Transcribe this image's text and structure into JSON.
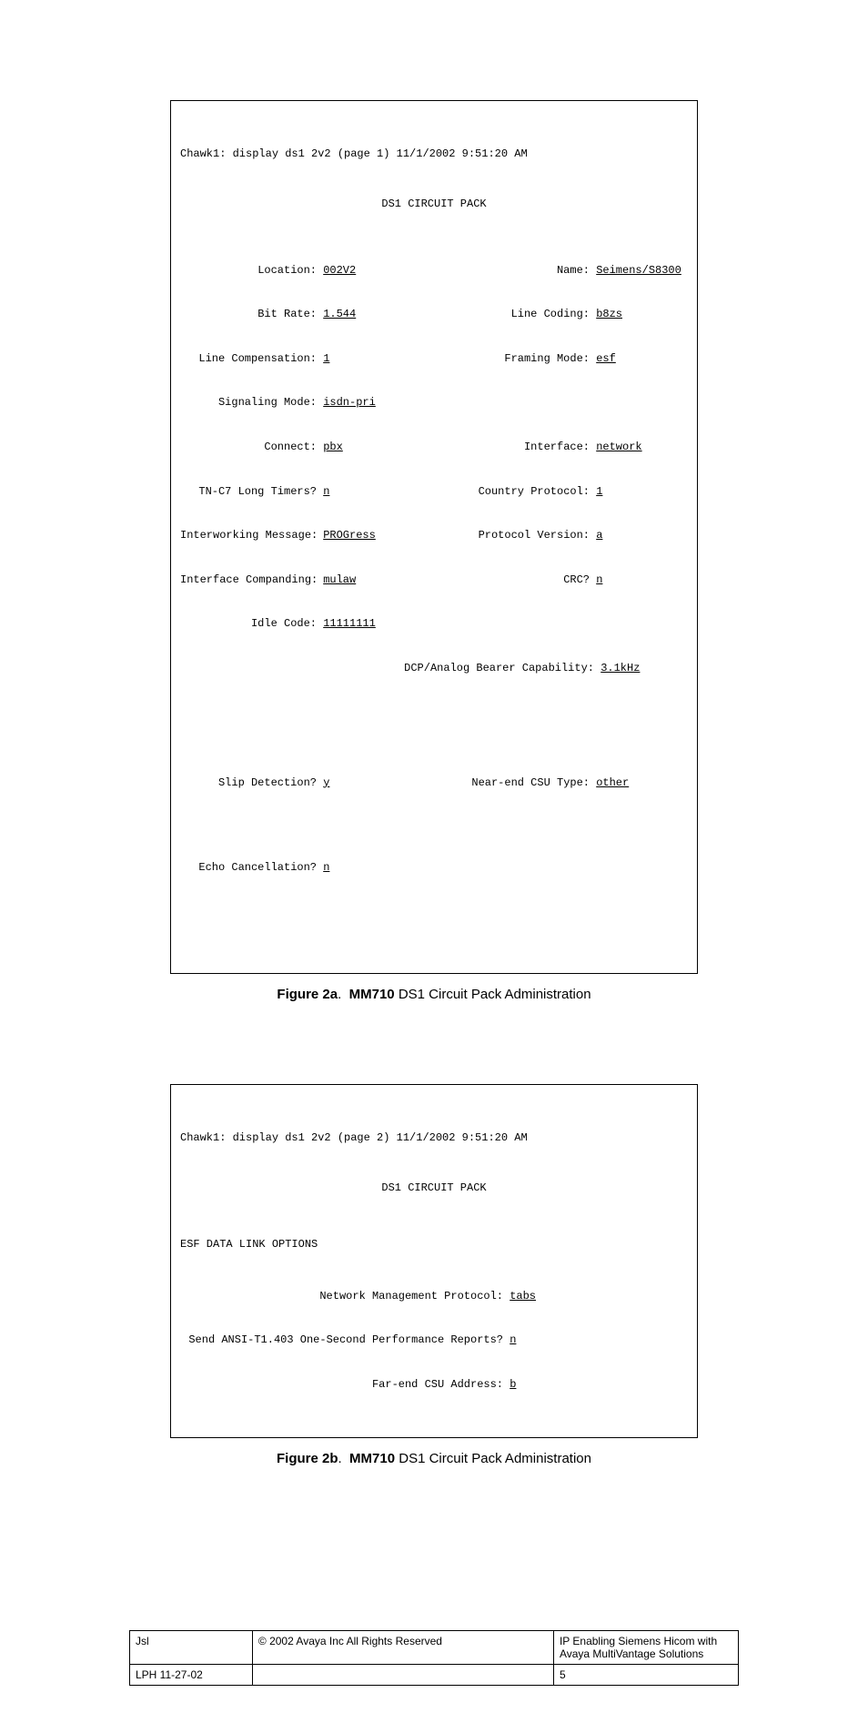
{
  "figA": {
    "header": "Chawk1: display ds1 2v2 (page 1) 11/1/2002 9:51:20 AM",
    "title": "DS1 CIRCUIT PACK",
    "left": {
      "location_lbl": "Location:",
      "location_val": "002V2",
      "bitrate_lbl": "Bit Rate:",
      "bitrate_val": "1.544",
      "linecomp_lbl": "Line Compensation:",
      "linecomp_val": "1",
      "sigmode_lbl": "Signaling Mode:",
      "sigmode_val": "isdn-pri",
      "connect_lbl": "Connect:",
      "connect_val": "pbx",
      "tnc7_lbl": "TN-C7 Long Timers?",
      "tnc7_val": "n",
      "intermsg_lbl": "Interworking Message:",
      "intermsg_val": "PROGress",
      "ifcomp_lbl": "Interface Companding:",
      "ifcomp_val": "mulaw",
      "idle_lbl": "Idle Code:",
      "idle_val": "11111111"
    },
    "right": {
      "name_lbl": "Name:",
      "name_val": "Seimens/S8300",
      "linecoding_lbl": "Line Coding:",
      "linecoding_val": "b8zs",
      "framing_lbl": "Framing Mode:",
      "framing_val": "esf",
      "interface_lbl": "Interface:",
      "interface_val": "network",
      "country_lbl": "Country Protocol:",
      "country_val": "1",
      "protver_lbl": "Protocol Version:",
      "protver_val": "a",
      "crc_lbl": "CRC?",
      "crc_val": "n"
    },
    "dcp_lbl": "DCP/Analog Bearer Capability:",
    "dcp_val": "3.1kHz",
    "slip_lbl": "Slip Detection?",
    "slip_val": "y",
    "nearend_lbl": "Near-end CSU Type:",
    "nearend_val": "other",
    "echo_lbl": "Echo Cancellation?",
    "echo_val": "n",
    "caption_num": "Figure 2a",
    "caption_bold": "MM710",
    "caption_rest": " DS1 Circuit Pack Administration"
  },
  "figB": {
    "header": "Chawk1: display ds1 2v2 (page 2) 11/1/2002 9:51:20 AM",
    "title": "DS1 CIRCUIT PACK",
    "section": "ESF DATA LINK OPTIONS",
    "nmp_lbl": "Network Management Protocol:",
    "nmp_val": "tabs",
    "ansi_lbl": "Send ANSI-T1.403 One-Second Performance Reports?",
    "ansi_val": "n",
    "farend_lbl": "Far-end CSU Address:",
    "farend_val": "b",
    "caption_num": "Figure 2b",
    "caption_bold": "MM710",
    "caption_rest": " DS1 Circuit Pack Administration"
  },
  "footer": {
    "r1c1": "Jsl",
    "r1c2": "© 2002 Avaya Inc All Rights Reserved",
    "r1c3": "IP Enabling Siemens Hicom with Avaya MultiVantage Solutions",
    "r2c1": "LPH 11-27-02",
    "r2c2": "",
    "r2c3": "5"
  }
}
